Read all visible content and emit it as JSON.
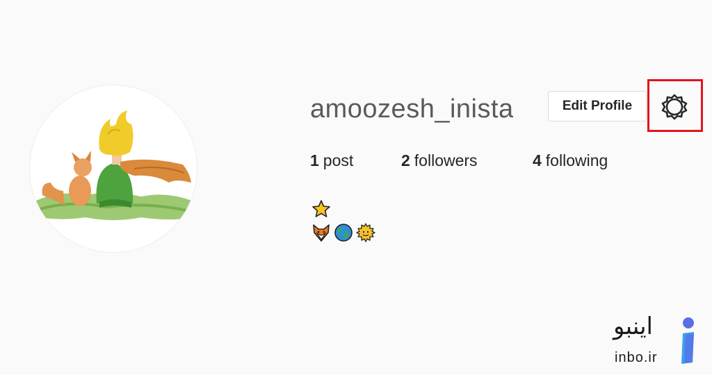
{
  "profile": {
    "username": "amoozesh_inista",
    "edit_profile_label": "Edit Profile",
    "stats": [
      {
        "count": "1",
        "label": "post"
      },
      {
        "count": "2",
        "label": "followers"
      },
      {
        "count": "4",
        "label": "following"
      }
    ],
    "bio_emoji_rows": [
      [
        "star-emoji"
      ],
      [
        "fox-emoji",
        "globe-emoji",
        "sun-emoji"
      ]
    ]
  },
  "icons": {
    "settings": "gear-icon"
  },
  "highlight_color": "#e3141b",
  "watermark": {
    "fa_text": "اینبو",
    "en_text": "inbo.ir"
  }
}
